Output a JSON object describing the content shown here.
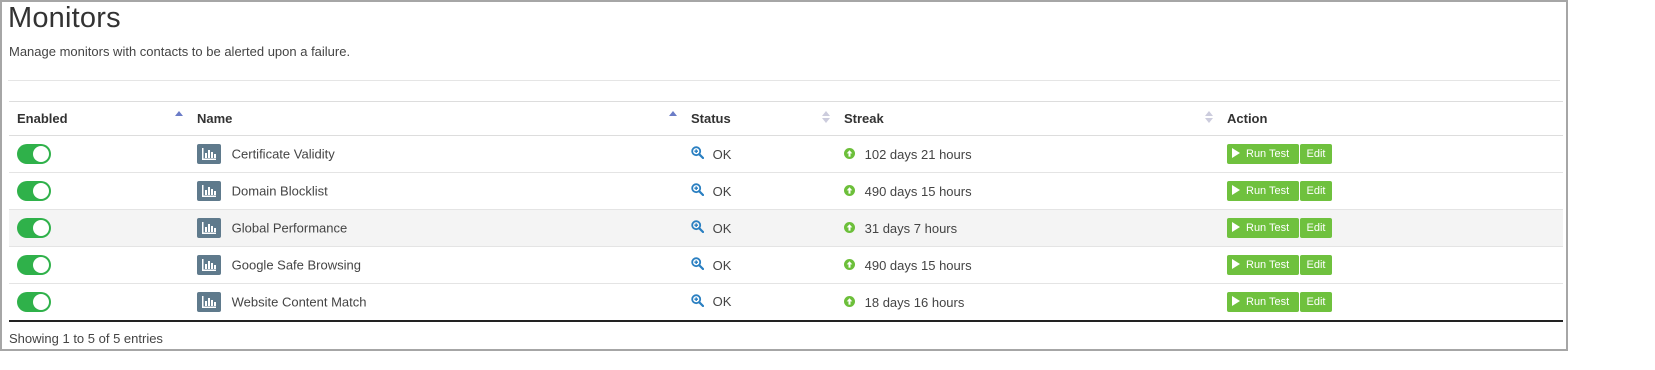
{
  "page": {
    "title": "Monitors",
    "subtitle": "Manage monitors with contacts to be alerted upon a failure."
  },
  "table": {
    "columns": {
      "enabled": "Enabled",
      "name": "Name",
      "status": "Status",
      "streak": "Streak",
      "action": "Action"
    },
    "rows": [
      {
        "enabled": true,
        "name": "Certificate Validity",
        "status": "OK",
        "streak": "102 days 21 hours"
      },
      {
        "enabled": true,
        "name": "Domain Blocklist",
        "status": "OK",
        "streak": "490 days 15 hours"
      },
      {
        "enabled": true,
        "name": "Global Performance",
        "status": "OK",
        "streak": "31 days 7 hours"
      },
      {
        "enabled": true,
        "name": "Google Safe Browsing",
        "status": "OK",
        "streak": "490 days 15 hours"
      },
      {
        "enabled": true,
        "name": "Website Content Match",
        "status": "OK",
        "streak": "18 days 16 hours"
      }
    ],
    "actions": {
      "run_test": "Run Test",
      "edit": "Edit"
    }
  },
  "footer": {
    "info": "Showing 1 to 5 of 5 entries"
  },
  "colors": {
    "toggle_on": "#2fb14a",
    "button_green": "#6fc13e",
    "badge": "#5f7a8c",
    "status_icon": "#2a7fc1",
    "streak_icon": "#6cbf3a"
  },
  "icons": {
    "name_badge": "bar-chart-icon",
    "status": "magnify-icon",
    "streak": "arrow-up-circle-icon",
    "run": "play-icon"
  }
}
